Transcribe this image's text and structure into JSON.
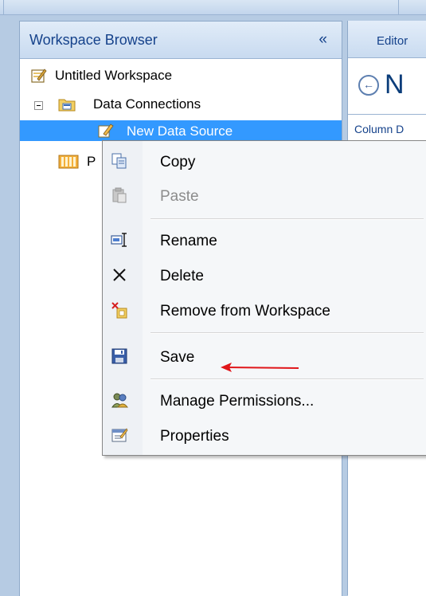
{
  "workspace_browser": {
    "title": "Workspace Browser",
    "collapse_glyph": "«",
    "tree": [
      {
        "label": "Untitled Workspace",
        "icon": "workspace-icon"
      },
      {
        "label": "Data Connections",
        "icon": "folder-icon",
        "expanded": true
      },
      {
        "label": "New Data Source",
        "icon": "data-source-icon",
        "selected": true
      },
      {
        "label": "P",
        "icon": "pages-icon"
      }
    ]
  },
  "editor": {
    "tab_label": "Editor",
    "title_partial": "N",
    "column_header_partial": "Column D"
  },
  "context_menu": {
    "items": [
      {
        "label": "Copy",
        "icon": "copy-icon",
        "enabled": true
      },
      {
        "label": "Paste",
        "icon": "paste-icon",
        "enabled": false
      },
      {
        "label": "Rename",
        "icon": "rename-icon",
        "enabled": true
      },
      {
        "label": "Delete",
        "icon": "delete-icon",
        "enabled": true
      },
      {
        "label": "Remove from Workspace",
        "icon": "remove-icon",
        "enabled": true
      },
      {
        "label": "Save",
        "icon": "save-icon",
        "enabled": true
      },
      {
        "label": "Manage Permissions...",
        "icon": "permissions-icon",
        "enabled": true
      },
      {
        "label": "Properties",
        "icon": "properties-icon",
        "enabled": true
      }
    ]
  },
  "annotation": {
    "type": "arrow",
    "color": "#e0161a",
    "points_to": "Save"
  },
  "colors": {
    "selection": "#3399ff",
    "panel_text": "#15428b",
    "arrow": "#e0161a"
  }
}
